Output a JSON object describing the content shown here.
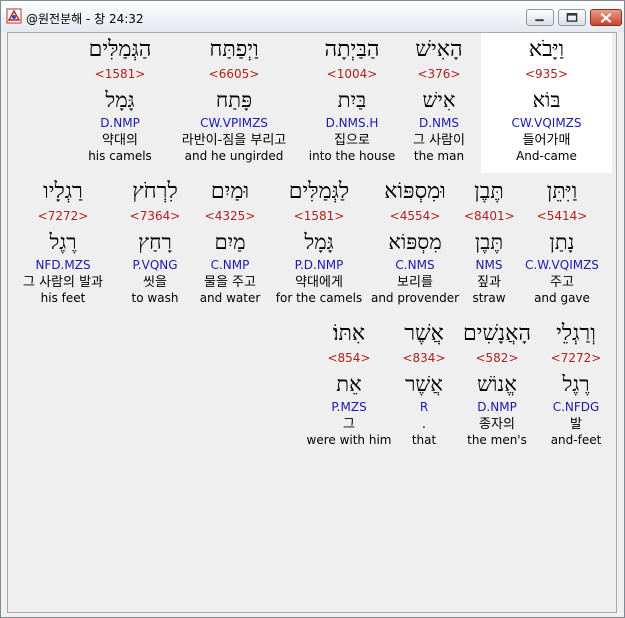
{
  "window": {
    "title": "@원전분해 - 창 24:32"
  },
  "rows": [
    [
      {
        "hebrew": "וַיָּבֹא",
        "strong": "<935>",
        "lemma": "בּוֹא",
        "morph": "CW.VQIMZS",
        "korean": "들어가매",
        "english": "And-came",
        "selected": true
      },
      {
        "hebrew": "הָאִישׁ",
        "strong": "<376>",
        "lemma": "אִישׁ",
        "morph": "D.NMS",
        "korean": "그 사람이",
        "english": "the man"
      },
      {
        "hebrew": "הַבַּיְתָה",
        "strong": "<1004>",
        "lemma": "בַּיִת",
        "morph": "D.NMS.H",
        "korean": "집으로",
        "english": "into the house"
      },
      {
        "hebrew": "וַיְפַתַּח",
        "strong": "<6605>",
        "lemma": "פָּתַח",
        "morph": "CW.VPIMZS",
        "korean": "라반이-짐을 부리고",
        "english": "and he ungirded"
      },
      {
        "hebrew": "הַגְּמַלִּים",
        "strong": "<1581>",
        "lemma": "גָּמָל",
        "morph": "D.NMP",
        "korean": "약대의",
        "english": "his camels"
      }
    ],
    [
      {
        "hebrew": "וַיִּתֵּן",
        "strong": "<5414>",
        "lemma": "נָתַן",
        "morph": "C.W.VQIMZS",
        "korean": "주고",
        "english": "and gave"
      },
      {
        "hebrew": "תֶּבֶן",
        "strong": "<8401>",
        "lemma": "תֶּבֶן",
        "morph": "NMS",
        "korean": "짚과",
        "english": "straw"
      },
      {
        "hebrew": "וּמִסְפּוֹא",
        "strong": "<4554>",
        "lemma": "מִסְפּוֹא",
        "morph": "C.NMS",
        "korean": "보리를",
        "english": "and provender"
      },
      {
        "hebrew": "לַגְּמַלִּים",
        "strong": "<1581>",
        "lemma": "גָּמָל",
        "morph": "P.D.NMP",
        "korean": "약대에게",
        "english": "for the camels"
      },
      {
        "hebrew": "וּמַיִם",
        "strong": "<4325>",
        "lemma": "מַיִם",
        "morph": "C.NMP",
        "korean": "물을 주고",
        "english": "and water"
      },
      {
        "hebrew": "לִרְחֹץ",
        "strong": "<7364>",
        "lemma": "רָחַץ",
        "morph": "P.VQNG",
        "korean": "씻을",
        "english": "to wash"
      },
      {
        "hebrew": "רַגְלָיו",
        "strong": "<7272>",
        "lemma": "רֶגֶל",
        "morph": "NFD.MZS",
        "korean": "그 사람의 발과",
        "english": "his feet"
      }
    ],
    [
      {
        "hebrew": "וְרַגְלֵי",
        "strong": "<7272>",
        "lemma": "רֶגֶל",
        "morph": "C.NFDG",
        "korean": "발",
        "english": "and-feet"
      },
      {
        "hebrew": "הָאֲנָשִׁים",
        "strong": "<582>",
        "lemma": "אֱנוֹשׁ",
        "morph": "D.NMP",
        "korean": "종자의",
        "english": "the men's"
      },
      {
        "hebrew": "אֲשֶׁר",
        "strong": "<834>",
        "lemma": "אֲשֶׁר",
        "morph": "R",
        "korean": ".",
        "english": "that"
      },
      {
        "hebrew": "אִתּוֹ׃",
        "strong": "<854>",
        "lemma": "אֵת",
        "morph": "P.MZS",
        "korean": "그",
        "english": "were with him"
      }
    ]
  ]
}
